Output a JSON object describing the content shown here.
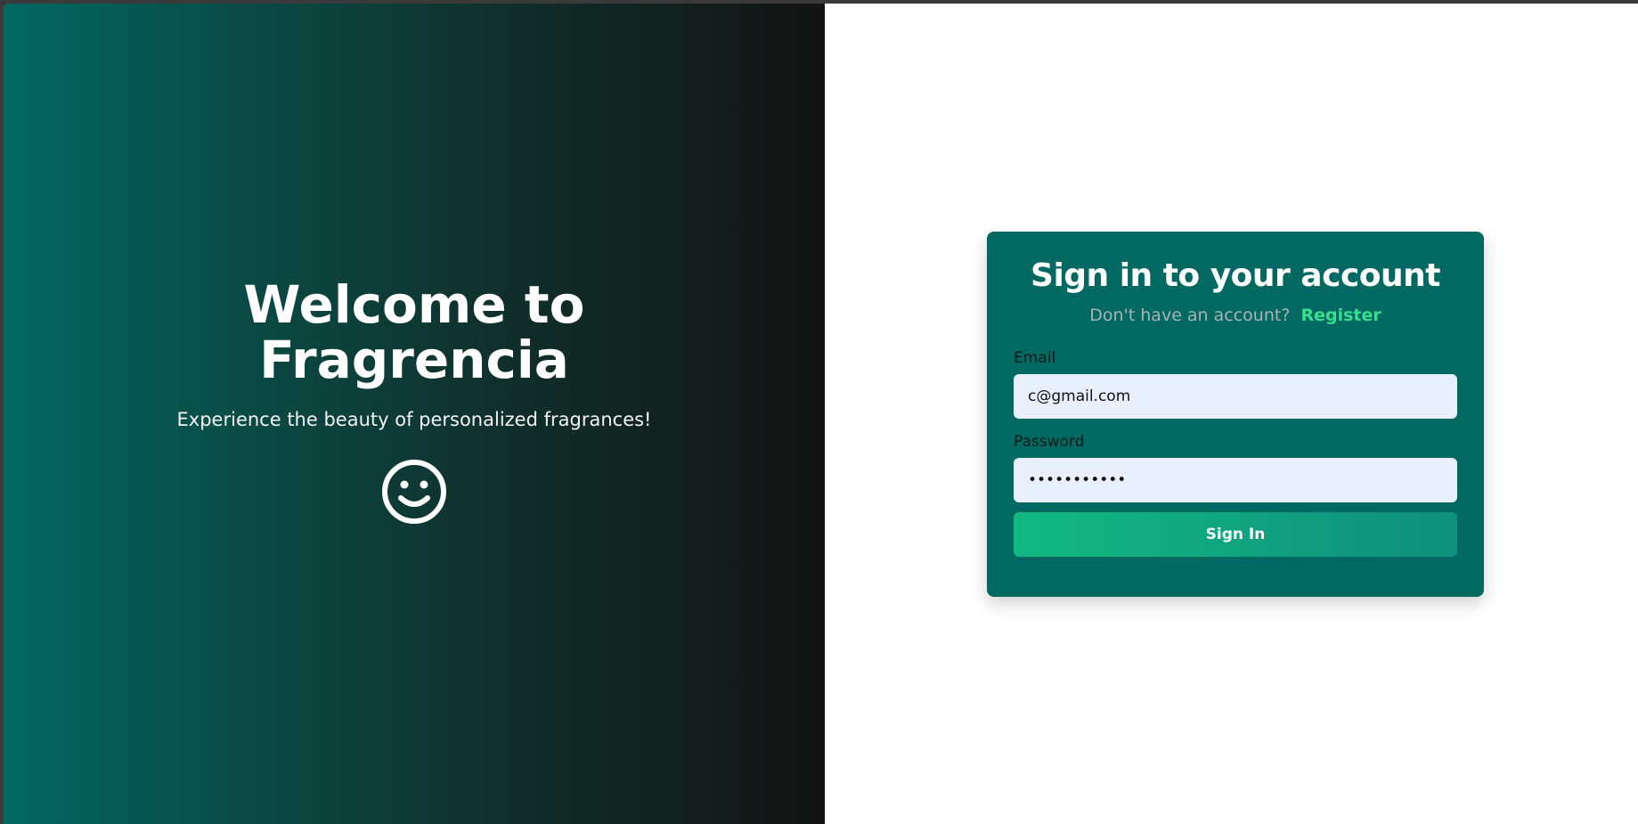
{
  "hero": {
    "title": "Welcome to Fragrencia",
    "subtitle": "Experience the beauty of personalized fragrances!",
    "icon": "smiley-icon"
  },
  "auth": {
    "title": "Sign in to your account",
    "signup_prompt": "Don't have an account?",
    "register_label": "Register",
    "email_label": "Email",
    "email_value": "c@gmail.com",
    "password_label": "Password",
    "password_value": "•••••••••••",
    "submit_label": "Sign In"
  },
  "colors": {
    "card_background": "#026862",
    "accent_green": "#35e08f",
    "button_start": "#12b981",
    "button_end": "#0f8f7d",
    "input_background": "#e8f0fe"
  }
}
